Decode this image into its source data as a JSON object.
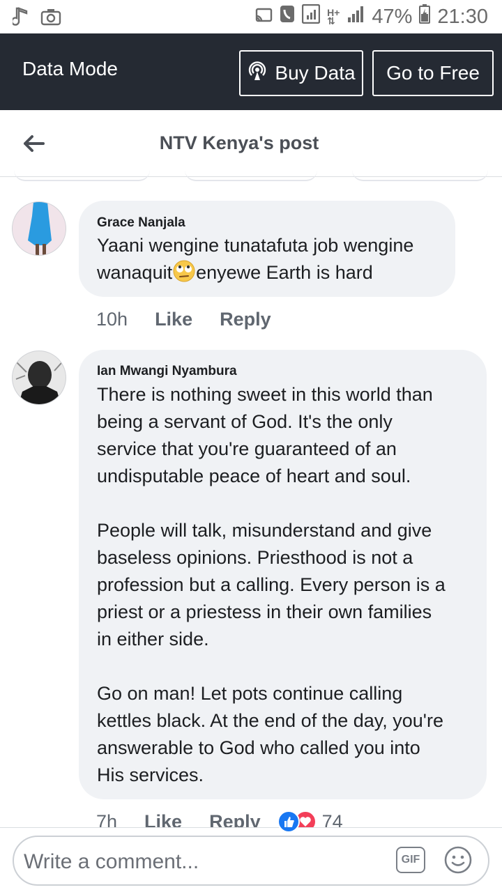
{
  "status_bar": {
    "battery": "47%",
    "time": "21:30"
  },
  "data_mode": {
    "title": "Data Mode",
    "buy_data": "Buy Data",
    "go_free": "Go to Free"
  },
  "header": {
    "title": "NTV Kenya's post"
  },
  "comments": [
    {
      "author": "Grace Nanjala",
      "lines": [
        "Yaani wengine tunatafuta job wengine",
        "wanaquit",
        "enyewe Earth is hard"
      ],
      "emoji": "face-with-rolling-eyes",
      "time": "10h",
      "like": "Like",
      "reply": "Reply"
    },
    {
      "author": "Ian Mwangi Nyambura",
      "lines": [
        "There is nothing sweet in this world than",
        "being a servant of God. It's the only",
        "service that you're guaranteed of an",
        "undisputable peace of heart and soul.",
        "",
        "People will talk, misunderstand and give",
        "baseless opinions. Priesthood is not a",
        "profession but a calling. Every person is a",
        "priest or a priestess in their own families",
        "in either side.",
        "",
        "Go on man! Let pots continue calling",
        "kettles black. At the end of the day, you're",
        "answerable to God who called you into",
        "His services."
      ],
      "time": "7h",
      "like": "Like",
      "reply": "Reply",
      "reactions_count": "74",
      "reaction_icons": [
        "like-reaction-icon",
        "love-reaction-icon"
      ]
    }
  ],
  "composer": {
    "placeholder": "Write a comment...",
    "gif": "GIF"
  },
  "colors": {
    "data_bar": "#252a33",
    "bubble": "#f0f2f5",
    "like_blue": "#1877f2",
    "love_red": "#f33e58"
  }
}
